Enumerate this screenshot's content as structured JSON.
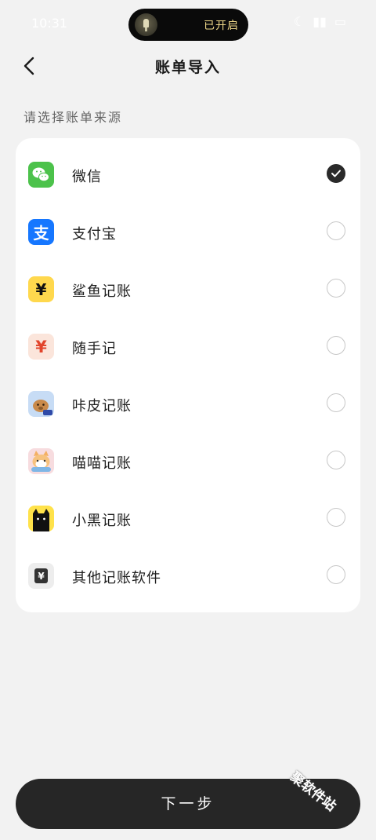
{
  "status_bar": {
    "time": "10:31",
    "island_text": "已开启",
    "icons": [
      "flashlight-icon",
      "moon-icon",
      "signal-icon",
      "battery-icon"
    ]
  },
  "header": {
    "title": "账单导入",
    "back_icon": "chevron-left-icon"
  },
  "section_label": "请选择账单来源",
  "options": [
    {
      "label": "微信",
      "icon": "wechat-icon",
      "checked": true
    },
    {
      "label": "支付宝",
      "icon": "alipay-icon",
      "checked": false
    },
    {
      "label": "鲨鱼记账",
      "icon": "shayu-icon",
      "checked": false
    },
    {
      "label": "随手记",
      "icon": "suishouji-icon",
      "checked": false
    },
    {
      "label": "咔皮记账",
      "icon": "kapi-icon",
      "checked": false
    },
    {
      "label": "喵喵记账",
      "icon": "miaomiao-icon",
      "checked": false
    },
    {
      "label": "小黑记账",
      "icon": "xiaohei-icon",
      "checked": false
    },
    {
      "label": "其他记账软件",
      "icon": "other-app-icon",
      "checked": false
    }
  ],
  "next_button": "下一步",
  "watermark": "聚软件站",
  "colors": {
    "background": "#f2f2f2",
    "card": "#ffffff",
    "button": "#262626",
    "wechat": "#4cc24b",
    "alipay": "#1677ff"
  }
}
